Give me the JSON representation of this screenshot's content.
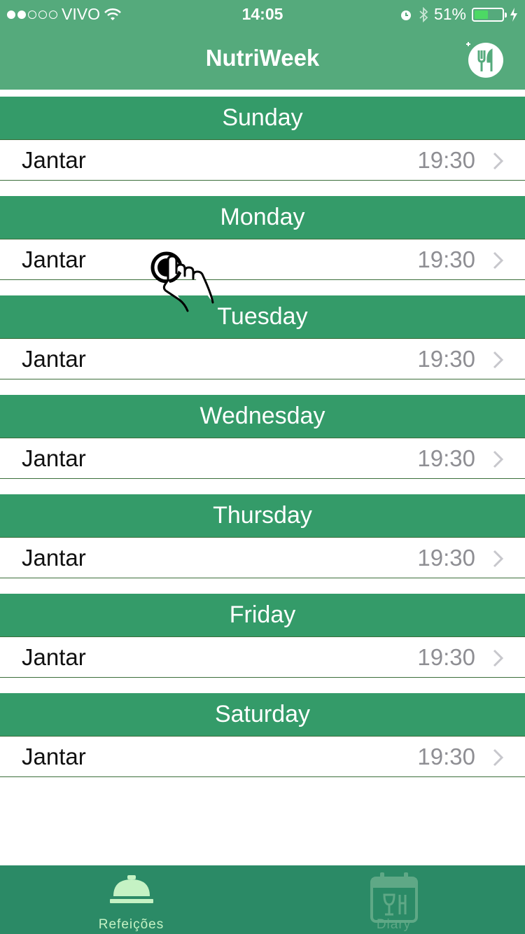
{
  "status_bar": {
    "carrier": "VIVO",
    "time": "14:05",
    "battery_percent_text": "51%",
    "battery_level": 0.51,
    "signal_bars_filled": 2,
    "signal_bars_total": 5
  },
  "nav": {
    "title": "NutriWeek",
    "menu_icon": "fork-knife-icon"
  },
  "days": [
    {
      "day": "Sunday",
      "meal": "Jantar",
      "time": "19:30"
    },
    {
      "day": "Monday",
      "meal": "Jantar",
      "time": "19:30"
    },
    {
      "day": "Tuesday",
      "meal": "Jantar",
      "time": "19:30"
    },
    {
      "day": "Wednesday",
      "meal": "Jantar",
      "time": "19:30"
    },
    {
      "day": "Thursday",
      "meal": "Jantar",
      "time": "19:30"
    },
    {
      "day": "Friday",
      "meal": "Jantar",
      "time": "19:30"
    },
    {
      "day": "Saturday",
      "meal": "Jantar",
      "time": "19:30"
    }
  ],
  "tabs": [
    {
      "label": "Refeições",
      "icon": "service-bell-icon",
      "active": true
    },
    {
      "label": "Diary",
      "icon": "calendar-dining-icon",
      "active": false
    }
  ],
  "colors": {
    "nav": "#55aa7c",
    "day_header": "#349b69",
    "tab_bar": "#2b8a66",
    "tab_active": "#c5f2c4",
    "tab_inactive": "#5fa886"
  }
}
